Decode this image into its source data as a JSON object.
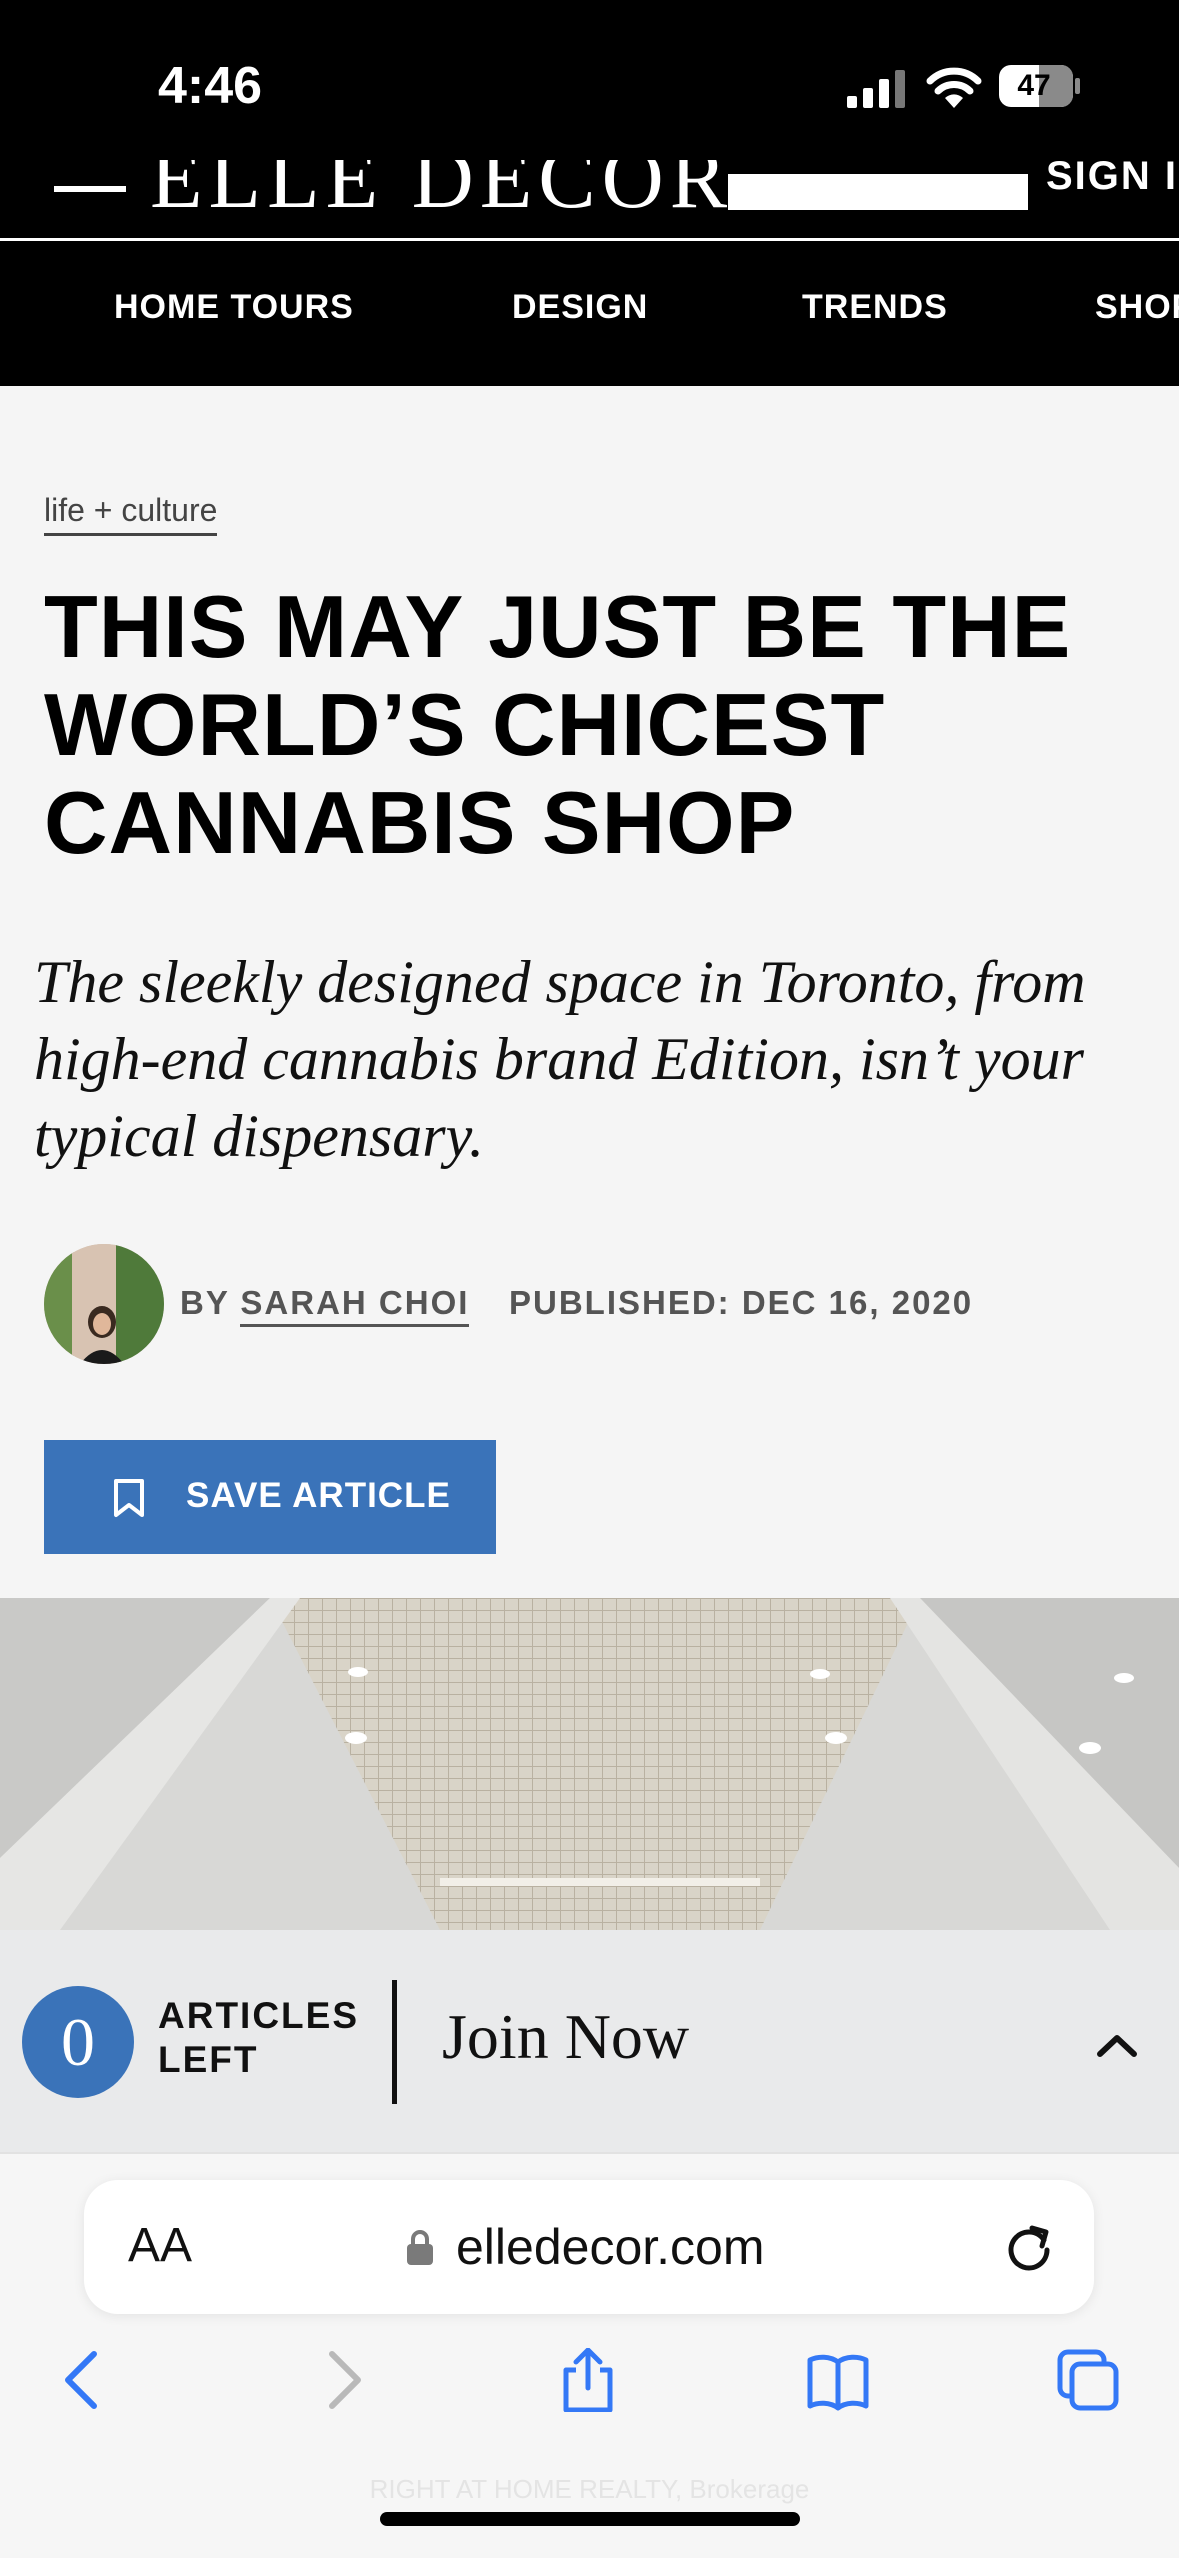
{
  "status_bar": {
    "time": "4:46",
    "battery_level": "47",
    "icons": [
      "signal-icon",
      "wifi-icon",
      "battery-icon"
    ]
  },
  "site_header": {
    "logo": "ELLE DECOR",
    "signin_label": "SIGN IN",
    "nav_items": [
      {
        "label": "HOME TOURS"
      },
      {
        "label": "DESIGN"
      },
      {
        "label": "TRENDS"
      },
      {
        "label": "SHOP"
      }
    ]
  },
  "article": {
    "category": "life + culture",
    "title": "THIS MAY JUST BE THE WORLD’S CHICEST CANNABIS SHOP",
    "dek": "The sleekly designed space in Toronto, from high-end cannabis brand Edition, isn’t your typical dispensary.",
    "byline_prefix": "BY",
    "author": "SARAH CHOI",
    "published": "PUBLISHED: DEC 16, 2020",
    "save_label": "SAVE ARTICLE"
  },
  "paywall": {
    "articles_left_count": "0",
    "articles_left_label": "ARTICLES LEFT",
    "join_label": "Join Now"
  },
  "browser": {
    "text_size_label": "AA",
    "url": "elledecor.com",
    "toolbar": [
      "back-icon",
      "forward-icon",
      "share-icon",
      "bookmarks-icon",
      "tabs-icon"
    ],
    "watermark": "RIGHT AT HOME REALTY, Brokerage"
  },
  "colors": {
    "accent_blue": "#3a73b9",
    "header_black": "#000000",
    "page_bg": "#f5f5f5",
    "safari_blue": "#3478f6"
  }
}
